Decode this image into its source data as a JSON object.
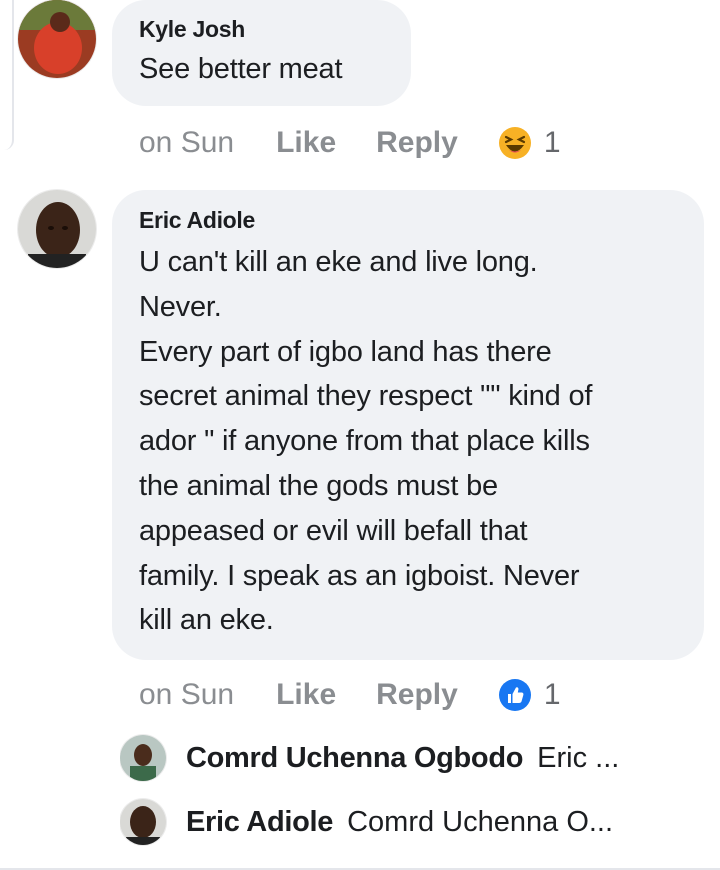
{
  "comments": [
    {
      "author": "Kyle Josh",
      "text": "See better meat",
      "time": "on Sun",
      "like_label": "Like",
      "reply_label": "Reply",
      "reaction_icon": "laughing-emoji-icon",
      "reaction_count": "1"
    },
    {
      "author": "Eric Adiole",
      "text_lines": [
        "U can't kill an eke and live long.",
        "Never.",
        "Every part of igbo land has there",
        "secret animal they respect \"\" kind of",
        "ador \" if anyone from that place kills",
        "the animal the gods must be",
        "appeased or evil will befall that",
        "family. I speak as an igboist. Never",
        "kill an eke."
      ],
      "time": "on Sun",
      "like_label": "Like",
      "reply_label": "Reply",
      "reaction_icon": "thumbs-up-icon",
      "reaction_count": "1"
    }
  ],
  "replies": [
    {
      "author": "Comrd Uchenna Ogbodo",
      "preview": "Eric ..."
    },
    {
      "author": "Eric Adiole",
      "preview": "Comrd Uchenna O..."
    }
  ],
  "colors": {
    "bubble": "#f0f2f5",
    "meta_text": "#8a8d91",
    "like_blue": "#1877f2",
    "emoji_yellow": "#f7b125"
  }
}
